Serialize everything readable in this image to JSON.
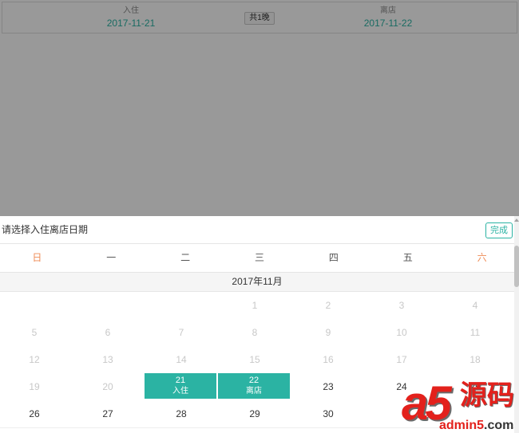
{
  "stay": {
    "checkin_label": "入住",
    "checkin_date": "2017-11-21",
    "nights": "共1晚",
    "checkout_label": "离店",
    "checkout_date": "2017-11-22"
  },
  "picker": {
    "title": "请选择入住离店日期",
    "done_label": "完成",
    "weekdays": [
      {
        "label": "日",
        "weekend": true
      },
      {
        "label": "一",
        "weekend": false
      },
      {
        "label": "二",
        "weekend": false
      },
      {
        "label": "三",
        "weekend": false
      },
      {
        "label": "四",
        "weekend": false
      },
      {
        "label": "五",
        "weekend": false
      },
      {
        "label": "六",
        "weekend": true
      }
    ],
    "month_label": "2017年11月",
    "weeks": [
      [
        null,
        null,
        null,
        {
          "day": "1",
          "state": "disabled"
        },
        {
          "day": "2",
          "state": "disabled"
        },
        {
          "day": "3",
          "state": "disabled"
        },
        {
          "day": "4",
          "state": "disabled"
        }
      ],
      [
        {
          "day": "5",
          "state": "disabled"
        },
        {
          "day": "6",
          "state": "disabled"
        },
        {
          "day": "7",
          "state": "disabled"
        },
        {
          "day": "8",
          "state": "disabled"
        },
        {
          "day": "9",
          "state": "disabled"
        },
        {
          "day": "10",
          "state": "disabled"
        },
        {
          "day": "11",
          "state": "disabled"
        }
      ],
      [
        {
          "day": "12",
          "state": "disabled"
        },
        {
          "day": "13",
          "state": "disabled"
        },
        {
          "day": "14",
          "state": "disabled"
        },
        {
          "day": "15",
          "state": "disabled"
        },
        {
          "day": "16",
          "state": "disabled"
        },
        {
          "day": "17",
          "state": "disabled"
        },
        {
          "day": "18",
          "state": "disabled"
        }
      ],
      [
        {
          "day": "19",
          "state": "disabled"
        },
        {
          "day": "20",
          "state": "disabled"
        },
        {
          "day": "21",
          "state": "check-in",
          "tag": "入住"
        },
        {
          "day": "22",
          "state": "check-out",
          "tag": "离店"
        },
        {
          "day": "23",
          "state": "available"
        },
        {
          "day": "24",
          "state": "available"
        },
        {
          "day": "25",
          "state": "available"
        }
      ],
      [
        {
          "day": "26",
          "state": "available"
        },
        {
          "day": "27",
          "state": "available"
        },
        {
          "day": "28",
          "state": "available"
        },
        {
          "day": "29",
          "state": "available"
        },
        {
          "day": "30",
          "state": "available"
        }
      ]
    ]
  },
  "icons": {
    "scroll_up": "scroll-up-arrow-icon"
  },
  "colors": {
    "accent": "#2bb3a3",
    "weekend": "#ef8b55",
    "disabled": "#c8c8c8",
    "text": "#333333"
  },
  "watermark": {
    "logo": "a5",
    "name": "源码",
    "domain": "admin5",
    "tld": ".com"
  }
}
